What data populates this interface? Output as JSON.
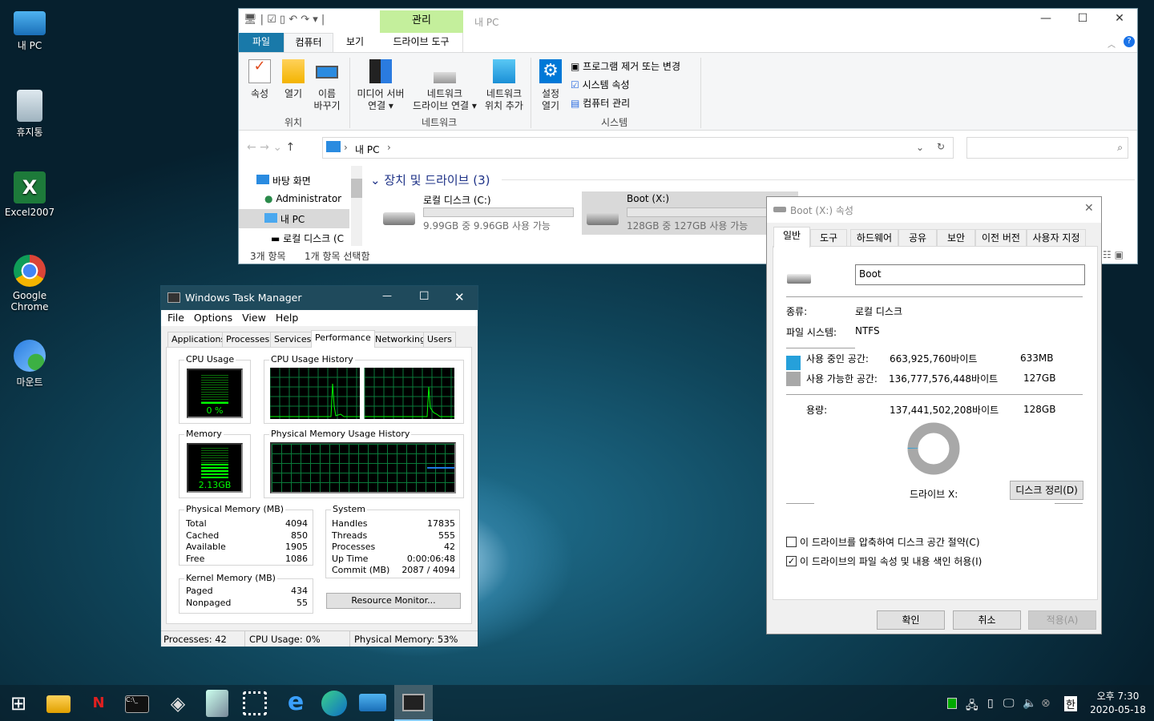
{
  "desktop": {
    "icons": [
      {
        "label": "내 PC"
      },
      {
        "label": "휴지통"
      },
      {
        "label": "Excel2007"
      },
      {
        "label": "Google Chrome"
      },
      {
        "label": "마운트"
      }
    ]
  },
  "explorer": {
    "title": "내 PC",
    "context_tab": "관리",
    "context_subtab": "드라이브 도구",
    "tabs": [
      "파일",
      "컴퓨터",
      "보기"
    ],
    "ribbon": {
      "location": {
        "label": "위치",
        "buttons": [
          "속성",
          "열기",
          "이름\n바꾸기"
        ]
      },
      "network": {
        "label": "네트워크",
        "buttons": [
          "미디어 서버\n연결 ▾",
          "네트워크\n드라이브 연결 ▾",
          "네트워크\n위치 추가"
        ]
      },
      "system": {
        "label": "시스템",
        "open_settings": "설정\n열기",
        "items": [
          "프로그램 제거 또는 변경",
          "시스템 속성",
          "컴퓨터 관리"
        ]
      }
    },
    "address": {
      "path": "내 PC"
    },
    "search_placeholder": "",
    "nav": [
      "바탕 화면",
      "Administrator",
      "내 PC",
      "로컬 디스크 (C"
    ],
    "section": "장치 및 드라이브 (3)",
    "drives": [
      {
        "name": "로컬 디스크 (C:)",
        "space": "9.99GB 중 9.96GB 사용 가능",
        "used_fraction": 0.003
      },
      {
        "name": "Boot (X:)",
        "space": "128GB 중 127GB 사용 가능",
        "used_fraction": 0.005
      }
    ],
    "status": {
      "items": "3개 항목",
      "selected": "1개 항목 선택함"
    }
  },
  "taskmgr": {
    "title": "Windows Task Manager",
    "menu": [
      "File",
      "Options",
      "View",
      "Help"
    ],
    "tabs": [
      "Applications",
      "Processes",
      "Services",
      "Performance",
      "Networking",
      "Users"
    ],
    "active_tab": "Performance",
    "cpu_usage": {
      "label": "CPU Usage",
      "value": "0 %"
    },
    "cpu_history": "CPU Usage History",
    "memory": {
      "label": "Memory",
      "value": "2.13GB"
    },
    "mem_history": "Physical Memory Usage History",
    "physical": {
      "label": "Physical Memory (MB)",
      "rows": [
        [
          "Total",
          "4094"
        ],
        [
          "Cached",
          "850"
        ],
        [
          "Available",
          "1905"
        ],
        [
          "Free",
          "1086"
        ]
      ]
    },
    "kernel": {
      "label": "Kernel Memory (MB)",
      "rows": [
        [
          "Paged",
          "434"
        ],
        [
          "Nonpaged",
          "55"
        ]
      ]
    },
    "system": {
      "label": "System",
      "rows": [
        [
          "Handles",
          "17835"
        ],
        [
          "Threads",
          "555"
        ],
        [
          "Processes",
          "42"
        ],
        [
          "Up Time",
          "0:00:06:48"
        ],
        [
          "Commit (MB)",
          "2087 / 4094"
        ]
      ]
    },
    "resource_monitor": "Resource Monitor...",
    "status": {
      "processes": "Processes: 42",
      "cpu": "CPU Usage: 0%",
      "memory": "Physical Memory: 53%"
    }
  },
  "props": {
    "title": "Boot (X:) 속성",
    "tabs": [
      "일반",
      "도구",
      "하드웨어",
      "공유",
      "보안",
      "이전 버전",
      "사용자 지정"
    ],
    "name": "Boot",
    "type_label": "종류:",
    "type": "로컬 디스크",
    "fs_label": "파일 시스템:",
    "fs": "NTFS",
    "used_label": "사용 중인 공간:",
    "used_bytes": "663,925,760바이트",
    "used_h": "633MB",
    "free_label": "사용 가능한 공간:",
    "free_bytes": "136,777,576,448바이트",
    "free_h": "127GB",
    "cap_label": "용량:",
    "cap_bytes": "137,441,502,208바이트",
    "cap_h": "128GB",
    "drive_label": "드라이브 X:",
    "cleanup": "디스크 정리(D)",
    "compress": {
      "label": "이 드라이브를 압축하여 디스크 공간 절약(C)",
      "checked": false
    },
    "index": {
      "label": "이 드라이브의 파일 속성 및 내용 색인 허용(I)",
      "checked": true
    },
    "ok": "확인",
    "cancel": "취소",
    "apply": "적용(A)",
    "colors": {
      "used": "#26a0da",
      "free": "#a8a8a8"
    }
  },
  "tray": {
    "ime": "한",
    "time": "오후 7:30",
    "date": "2020-05-18"
  }
}
